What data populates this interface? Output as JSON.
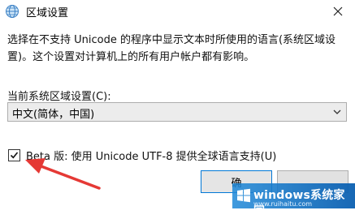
{
  "window": {
    "title": "区域设置",
    "app_icon": "globe-icon",
    "close_icon": "close-icon"
  },
  "description": "选择在不支持 Unicode 的程序中显示文本时所使用的语言(系统区域设置)。这个设置对计算机上的所有用户帐户都有影响。",
  "current_locale": {
    "label": "当前系统区域设置(C):",
    "selected": "中文(简体，中国)"
  },
  "beta_option": {
    "checked": true,
    "label": "Beta 版: 使用 Unicode UTF-8 提供全球语言支持(U)"
  },
  "buttons": {
    "ok": "确",
    "cancel": ""
  },
  "watermark": {
    "brand": "windows系统家园",
    "site": "www.ruihaitu.com"
  },
  "colors": {
    "accent": "#0078d7",
    "annotation_arrow": "#e53935"
  }
}
